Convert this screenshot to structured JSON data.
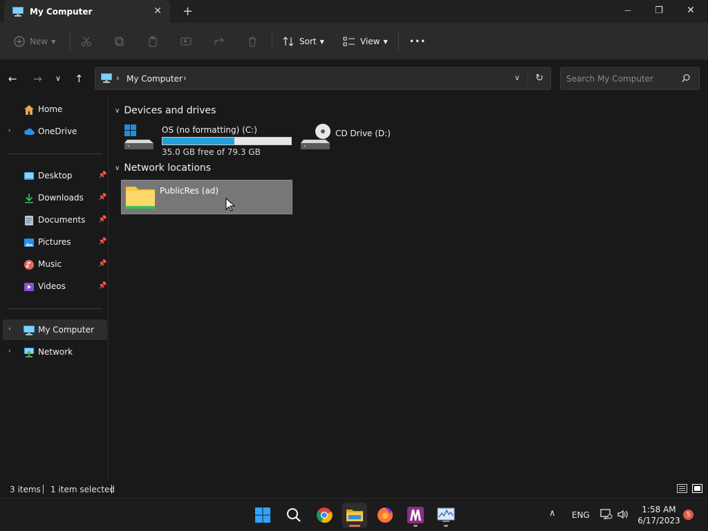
{
  "window": {
    "tab_title": "My Computer",
    "tab_close": "✕",
    "new_tab": "+",
    "minimize": "—",
    "maximize": "❐",
    "close": "✕"
  },
  "toolbar": {
    "new_label": "New",
    "sort_label": "Sort",
    "view_label": "View",
    "more_label": "•••"
  },
  "nav": {
    "breadcrumb": "My Computer",
    "search_placeholder": "Search My Computer"
  },
  "sidebar": {
    "items": [
      {
        "label": "Home"
      },
      {
        "label": "OneDrive"
      },
      {
        "label": "Desktop"
      },
      {
        "label": "Downloads"
      },
      {
        "label": "Documents"
      },
      {
        "label": "Pictures"
      },
      {
        "label": "Music"
      },
      {
        "label": "Videos"
      },
      {
        "label": "My Computer"
      },
      {
        "label": "Network"
      }
    ]
  },
  "content": {
    "devices_header": "Devices and drives",
    "network_header": "Network locations",
    "drive_c": {
      "name": "OS (no formatting) (C:)",
      "free": "35.0 GB free of 79.3 GB",
      "used_fraction": 0.559
    },
    "drive_d": {
      "name": "CD Drive (D:)"
    },
    "network_location": {
      "name": "PublicRes (ad)"
    }
  },
  "status": {
    "items": "3 items",
    "selected": "1 item selected"
  },
  "tray": {
    "language": "ENG",
    "time": "1:58 AM",
    "date": "6/17/2023",
    "notifications": "5"
  },
  "colors": {
    "accent": "#26a0da",
    "selection": "#777777",
    "folder": "#f5c842"
  }
}
